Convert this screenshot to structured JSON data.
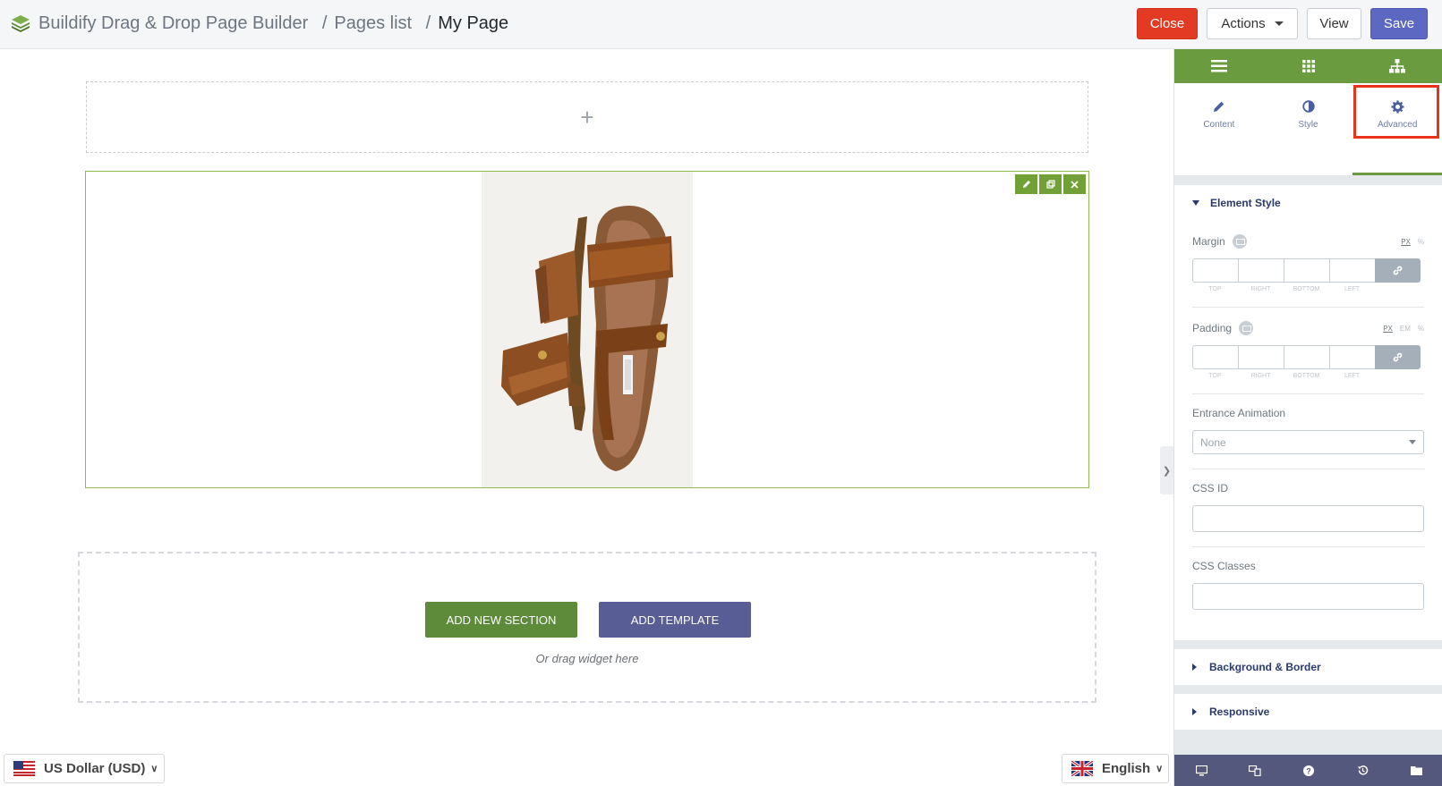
{
  "header": {
    "app_title": "Buildify Drag & Drop Page Builder",
    "sep1": "/",
    "crumb_pages": "Pages list",
    "sep2": "/",
    "crumb_current": "My Page",
    "close_label": "Close",
    "actions_label": "Actions",
    "view_label": "View",
    "save_label": "Save"
  },
  "canvas": {
    "add_icon": "+",
    "add_new_section": "ADD NEW SECTION",
    "add_template": "ADD TEMPLATE",
    "drag_hint": "Or drag widget here"
  },
  "footer": {
    "currency": "US Dollar (USD)",
    "language": "English"
  },
  "panel": {
    "tabs": [
      {
        "label": "Content",
        "icon": "pencil-icon"
      },
      {
        "label": "Style",
        "icon": "contrast-icon"
      },
      {
        "label": "Advanced",
        "icon": "gear-icon"
      }
    ],
    "active_tab": "Advanced",
    "element_style": {
      "title": "Element Style",
      "margin": {
        "label": "Margin",
        "units": [
          "PX",
          "%"
        ],
        "active_unit": "PX",
        "sides": [
          "TOP",
          "RIGHT",
          "BOTTOM",
          "LEFT"
        ]
      },
      "padding": {
        "label": "Padding",
        "units": [
          "PX",
          "EM",
          "%"
        ],
        "active_unit": "PX",
        "sides": [
          "TOP",
          "RIGHT",
          "BOTTOM",
          "LEFT"
        ]
      },
      "entrance_animation": {
        "label": "Entrance Animation",
        "value": "None"
      },
      "css_id": {
        "label": "CSS ID",
        "value": ""
      },
      "css_classes": {
        "label": "CSS Classes",
        "value": ""
      }
    },
    "background_border": "Background & Border",
    "responsive": "Responsive"
  },
  "colors": {
    "accent_green": "#6a9b3f",
    "close_red": "#e33a24",
    "save_blue": "#5c68c2",
    "template_purple": "#585d96",
    "footer_navy": "#54587d"
  }
}
